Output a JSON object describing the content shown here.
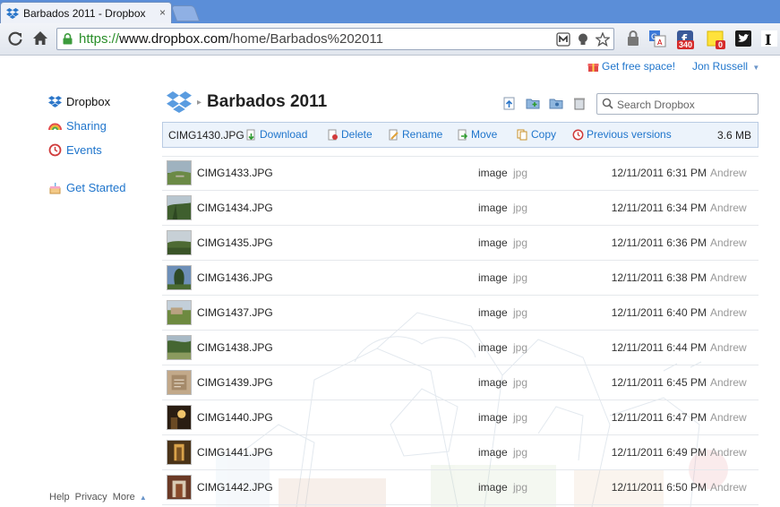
{
  "browser": {
    "tab_title": "Barbados 2011 - Dropbox",
    "tab_close": "×",
    "url_scheme": "https://",
    "url_domain": "www.dropbox.com",
    "url_path": "/home/Barbados%202011",
    "ext_badge_1": "340",
    "ext_badge_2": "0"
  },
  "header": {
    "free_space": "Get free space!",
    "user": "Jon Russell",
    "user_caret": "▼"
  },
  "sidebar": {
    "items": [
      {
        "label": "Dropbox"
      },
      {
        "label": "Sharing"
      },
      {
        "label": "Events"
      },
      {
        "label": "Get Started"
      }
    ]
  },
  "footer": {
    "help": "Help",
    "privacy": "Privacy",
    "more": "More",
    "more_caret": "▲"
  },
  "breadcrumb": {
    "arrow": "▸",
    "title": "Barbados 2011"
  },
  "search": {
    "placeholder": "Search Dropbox"
  },
  "selection": {
    "filename": "CIMG1430.JPG",
    "size": "3.6 MB",
    "actions": {
      "download": "Download",
      "delete": "Delete",
      "rename": "Rename",
      "move": "Move",
      "copy": "Copy",
      "versions": "Previous versions"
    }
  },
  "files": [
    {
      "name": "CIMG1433.JPG",
      "kind": "image",
      "ext": "jpg",
      "date": "12/11/2011 6:31 PM",
      "who": "Andrew"
    },
    {
      "name": "CIMG1434.JPG",
      "kind": "image",
      "ext": "jpg",
      "date": "12/11/2011 6:34 PM",
      "who": "Andrew"
    },
    {
      "name": "CIMG1435.JPG",
      "kind": "image",
      "ext": "jpg",
      "date": "12/11/2011 6:36 PM",
      "who": "Andrew"
    },
    {
      "name": "CIMG1436.JPG",
      "kind": "image",
      "ext": "jpg",
      "date": "12/11/2011 6:38 PM",
      "who": "Andrew"
    },
    {
      "name": "CIMG1437.JPG",
      "kind": "image",
      "ext": "jpg",
      "date": "12/11/2011 6:40 PM",
      "who": "Andrew"
    },
    {
      "name": "CIMG1438.JPG",
      "kind": "image",
      "ext": "jpg",
      "date": "12/11/2011 6:44 PM",
      "who": "Andrew"
    },
    {
      "name": "CIMG1439.JPG",
      "kind": "image",
      "ext": "jpg",
      "date": "12/11/2011 6:45 PM",
      "who": "Andrew"
    },
    {
      "name": "CIMG1440.JPG",
      "kind": "image",
      "ext": "jpg",
      "date": "12/11/2011 6:47 PM",
      "who": "Andrew"
    },
    {
      "name": "CIMG1441.JPG",
      "kind": "image",
      "ext": "jpg",
      "date": "12/11/2011 6:49 PM",
      "who": "Andrew"
    },
    {
      "name": "CIMG1442.JPG",
      "kind": "image",
      "ext": "jpg",
      "date": "12/11/2011 6:50 PM",
      "who": "Andrew"
    }
  ],
  "colors": {
    "link": "#1f75cc",
    "selection_bg": "#ecf3fb",
    "tabstrip": "#5b8ed8"
  }
}
